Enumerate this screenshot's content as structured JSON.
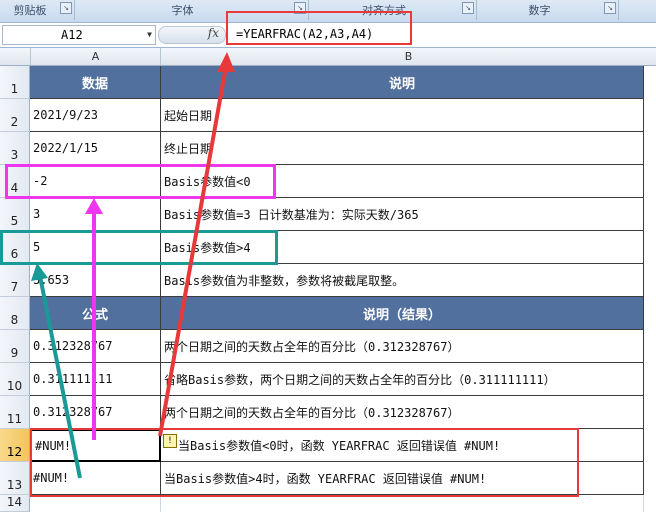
{
  "ribbon": {
    "groups": [
      "剪贴板",
      "字体",
      "对齐方式",
      "数字"
    ]
  },
  "formula_bar": {
    "name_box": "A12",
    "fx": "fx",
    "formula": "=YEARFRAC(A2,A3,A4)"
  },
  "columns": [
    "A",
    "B"
  ],
  "rows": [
    "1",
    "2",
    "3",
    "4",
    "5",
    "6",
    "7",
    "8",
    "9",
    "10",
    "11",
    "12",
    "13",
    "14"
  ],
  "sheet": {
    "r1": {
      "a": "数据",
      "b": "说明"
    },
    "r2": {
      "a": "2021/9/23",
      "b": "起始日期"
    },
    "r3": {
      "a": "2022/1/15",
      "b": "终止日期"
    },
    "r4": {
      "a": "-2",
      "b": "Basis参数值<0"
    },
    "r5": {
      "a": "3",
      "b": "Basis参数值=3    日计数基准为：实际天数/365"
    },
    "r6": {
      "a": "5",
      "b": "Basis参数值>4"
    },
    "r7": {
      "a": "3.653",
      "b": "Basis参数值为非整数，参数将被截尾取整。"
    },
    "r8": {
      "a": "公式",
      "b": "说明（结果）"
    },
    "r9": {
      "a": "0.312328767",
      "b": "两个日期之间的天数占全年的百分比（0.312328767）"
    },
    "r10": {
      "a": "0.311111111",
      "b": "省略Basis参数，两个日期之间的天数占全年的百分比（0.311111111）"
    },
    "r11": {
      "a": "0.312328767",
      "b": "两个日期之间的天数占全年的百分比（0.312328767）"
    },
    "r12": {
      "a": "#NUM!",
      "b": "当Basis参数值<0时，函数 YEARFRAC 返回错误值 #NUM!"
    },
    "r13": {
      "a": "#NUM!",
      "b": "当Basis参数值>4时，函数 YEARFRAC 返回错误值 #NUM!"
    }
  },
  "colors": {
    "header_fill": "#52709e",
    "annotation_red": "#e8393a",
    "annotation_magenta": "#ee36ee",
    "annotation_teal": "#1a9a96"
  },
  "icons": {
    "error_indicator": "warning-icon",
    "name_box_dropdown": "chevron-down-icon"
  }
}
